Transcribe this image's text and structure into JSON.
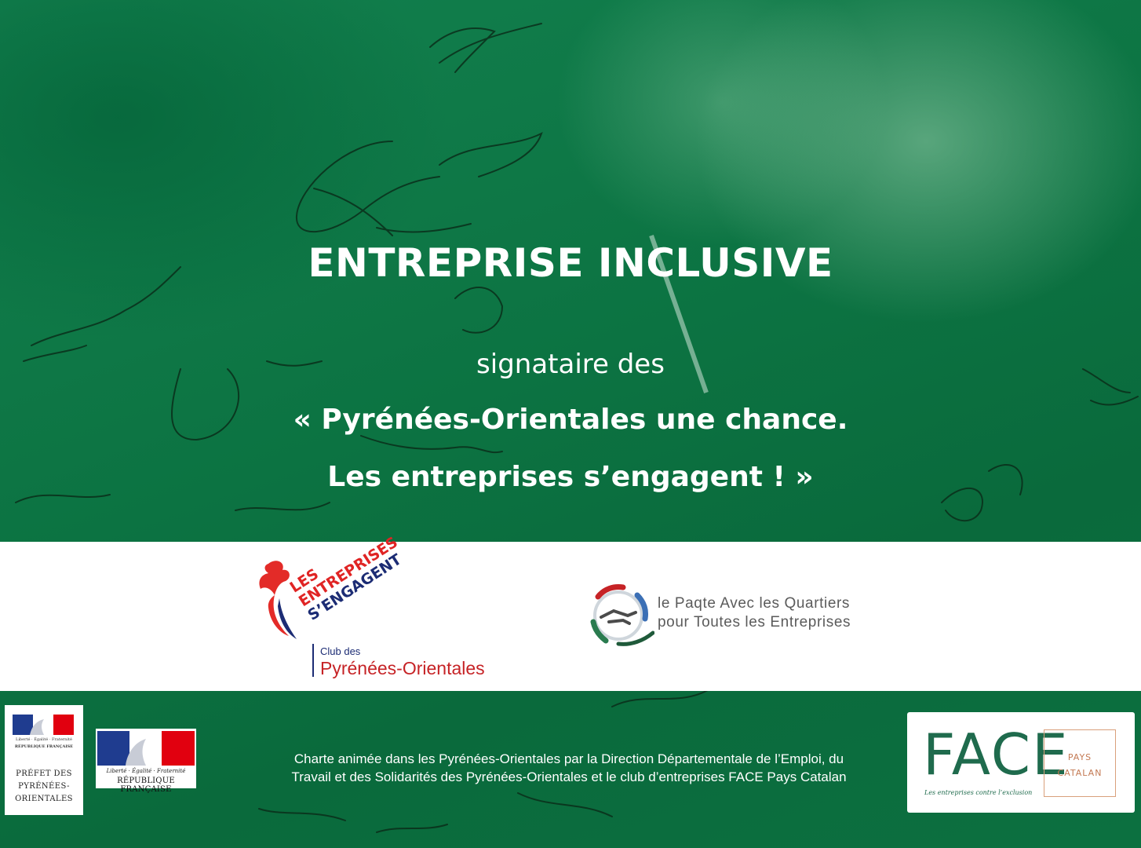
{
  "poster": {
    "headline": "ENTREPRISE INCLUSIVE",
    "intro": "signataire des",
    "quote_line_1": "« Pyrénées-Orientales une chance.",
    "quote_line_2": "Les entreprises s’engagent ! »",
    "background_color": "#0c7342"
  },
  "logo_band": {
    "engagent_logo": {
      "word_1": "LES",
      "word_2": "ENTREPRISES",
      "word_3": "S’ENGAGENT",
      "club_label": "Club des",
      "club_name": "Pyrénées-Orientales"
    },
    "paqte_logo": {
      "line_1": "le Paqte Avec les Quartiers",
      "line_2": "pour Toutes les Entreprises"
    }
  },
  "footer": {
    "prefecture_logo": {
      "motto": "Liberté · Égalité · Fraternité",
      "republic": "RÉPUBLIQUE FRANÇAISE",
      "prefet_line_1": "PRÉFET DES",
      "prefet_line_2": "PYRÉNÉES-",
      "prefet_line_3": "ORIENTALES"
    },
    "republique_logo": {
      "motto": "Liberté · Égalité · Fraternité",
      "republic": "RÉPUBLIQUE FRANÇAISE"
    },
    "charter_line_1": "Charte animée dans les Pyrénées-Orientales par la Direction Départementale de l’Emploi, du",
    "charter_line_2": "Travail et des Solidarités des Pyrénées-Orientales et le club d’entreprises FACE Pays Catalan",
    "face_logo": {
      "word": "FACE",
      "box_line_1": "PAYS",
      "box_line_2": "CATALAN",
      "tagline": "Les entreprises contre l’exclusion"
    }
  }
}
